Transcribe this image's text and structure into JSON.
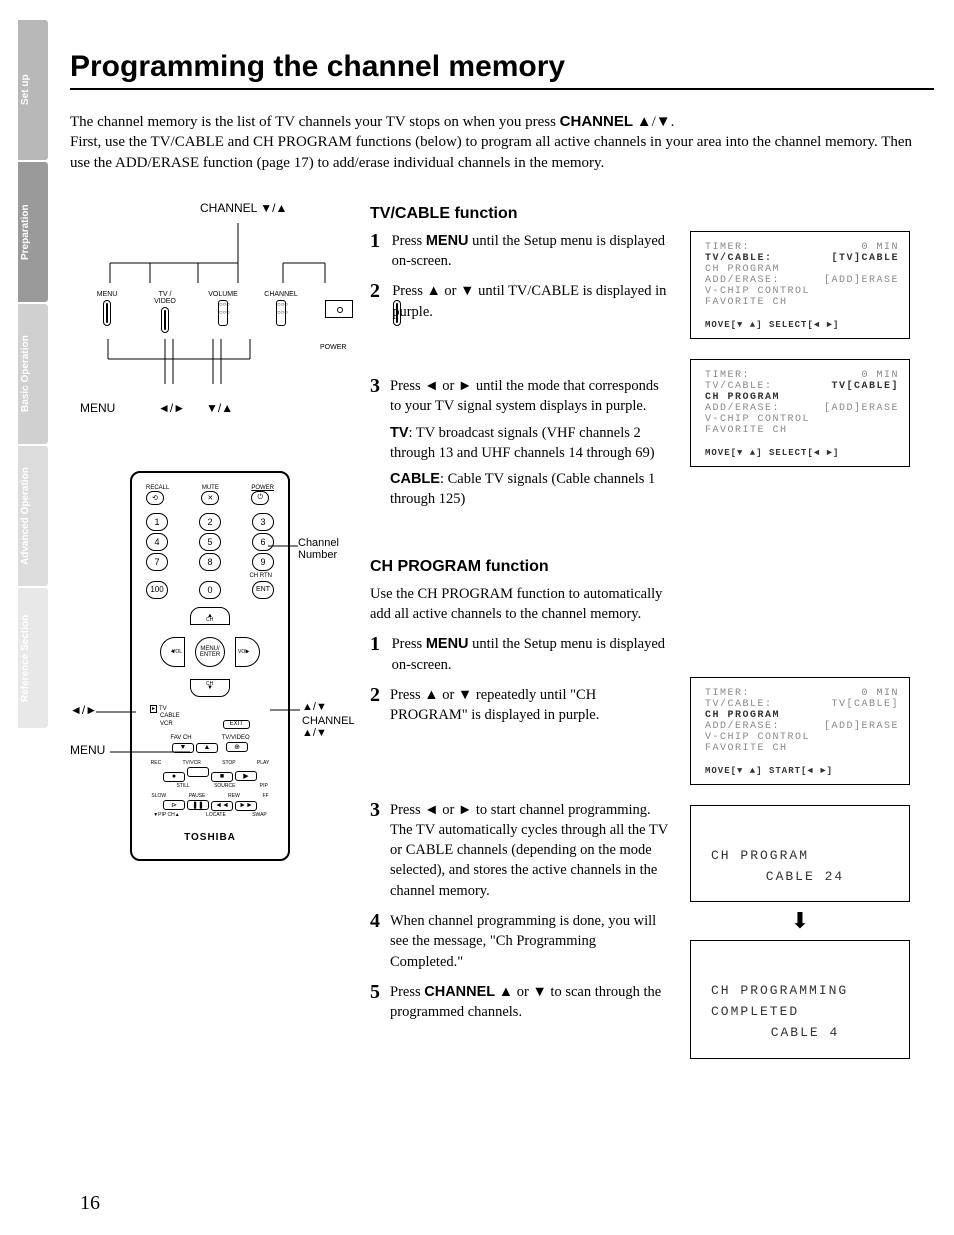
{
  "page_number": "16",
  "side_tabs": [
    "Set up",
    "Preparation",
    "Basic Operation",
    "Advanced Operation",
    "Reference Section"
  ],
  "title": "Programming the channel memory",
  "intro": {
    "line1_a": "The channel memory is the list of TV channels your TV stops on when you press ",
    "line1_b": "CHANNEL",
    "line1_c": " ▲/▼.",
    "line2": "First, use the TV/CABLE and CH PROGRAM functions (below) to program all active channels in your area into the channel memory. Then use the ADD/ERASE function (page 17) to add/erase individual channels in the memory."
  },
  "panel": {
    "channel_label": "CHANNEL ▼/▲",
    "buttons": [
      "MENU",
      "TV / VIDEO",
      "VOLUME",
      "CHANNEL"
    ],
    "power": "POWER",
    "bottom": {
      "menu": "MENU",
      "arrows1": "◄/►",
      "arrows2": "▼/▲"
    }
  },
  "remote": {
    "top": {
      "recall": "RECALL",
      "mute": "MUTE",
      "power": "POWER"
    },
    "numbers": [
      "1",
      "2",
      "3",
      "4",
      "5",
      "6",
      "7",
      "8",
      "9",
      "100",
      "0",
      "ENT"
    ],
    "chrtn": "CH RTN",
    "dpad": {
      "ch": "CH",
      "vol": "VOL",
      "center": "MENU/\nENTER"
    },
    "slide": {
      "tv": "TV",
      "cable": "CABLE",
      "vcr": "VCR",
      "exit": "EXIT"
    },
    "row_a": {
      "favch": "FAV CH",
      "tvvideo": "TV/VIDEO"
    },
    "row_b": [
      "REC",
      "TV/VCR",
      "STOP",
      "PLAY"
    ],
    "row_c": [
      "STILL",
      "SOURCE",
      "PIP"
    ],
    "row_d": [
      "SLOW",
      "PAUSE",
      "REW",
      "FF"
    ],
    "row_e": [
      "▼PIP CH▲",
      "LOCATE",
      "SWAP"
    ],
    "brand": "TOSHIBA"
  },
  "remote_callouts": {
    "channel_number": "Channel\nNumber",
    "arrows_lr": "◄/►",
    "menu": "MENU",
    "arrows_ud": "▲/▼",
    "channel_ud": "CHANNEL\n▲/▼"
  },
  "tvcable": {
    "heading": "TV/CABLE function",
    "step1_a": "Press ",
    "step1_b": "MENU",
    "step1_c": " until the Setup menu is displayed on-screen.",
    "step2": "Press ▲ or ▼ until TV/CABLE is displayed in purple.",
    "step3_a": "Press ◄ or ► until the mode that corresponds to your TV signal system displays in purple.",
    "step3_tv_label": "TV",
    "step3_tv_desc": ":  TV broadcast signals (VHF channels 2 through 13 and UHF channels 14 through 69)",
    "step3_cable_label": "CABLE",
    "step3_cable_desc": ":  Cable TV signals (Cable channels 1 through 125)"
  },
  "osd1": {
    "timer": "TIMER:",
    "timer_v": "0 MIN",
    "tvcable": "TV/CABLE:",
    "tvcable_v": "[TV]CABLE",
    "chprogram": "CH PROGRAM",
    "adderase": "ADD/ERASE:",
    "adderase_v": "[ADD]ERASE",
    "vchip": "V-CHIP CONTROL",
    "fav": "FAVORITE CH",
    "foot": "MOVE[▼ ▲] SELECT[◄ ►]"
  },
  "osd2": {
    "tvcable_v": "TV[CABLE]"
  },
  "chprog": {
    "heading": "CH PROGRAM function",
    "desc": "Use the CH PROGRAM function to automatically add all active channels to the channel memory.",
    "step1_a": "Press ",
    "step1_b": "MENU",
    "step1_c": " until the Setup menu is displayed on-screen.",
    "step2": "Press ▲ or ▼ repeatedly until \"CH PROGRAM\" is displayed in purple.",
    "step3": "Press ◄ or ► to start channel programming. The TV automatically cycles through all the TV or CABLE channels (depending on the mode selected), and stores the active channels in the channel memory.",
    "step4": "When channel programming is done, you will see the message, \"Ch Programming Completed.\"",
    "step5_a": "Press ",
    "step5_b": "CHANNEL",
    "step5_c": " ▲ or ▼ to scan through the programmed channels."
  },
  "osd3": {
    "foot": "MOVE[▼ ▲] START[◄ ►]"
  },
  "osd_big1": {
    "l1": "CH PROGRAM",
    "l2": "CABLE 24"
  },
  "osd_big2": {
    "l1": "CH PROGRAMMING",
    "l2": "COMPLETED",
    "l3": "CABLE   4"
  }
}
